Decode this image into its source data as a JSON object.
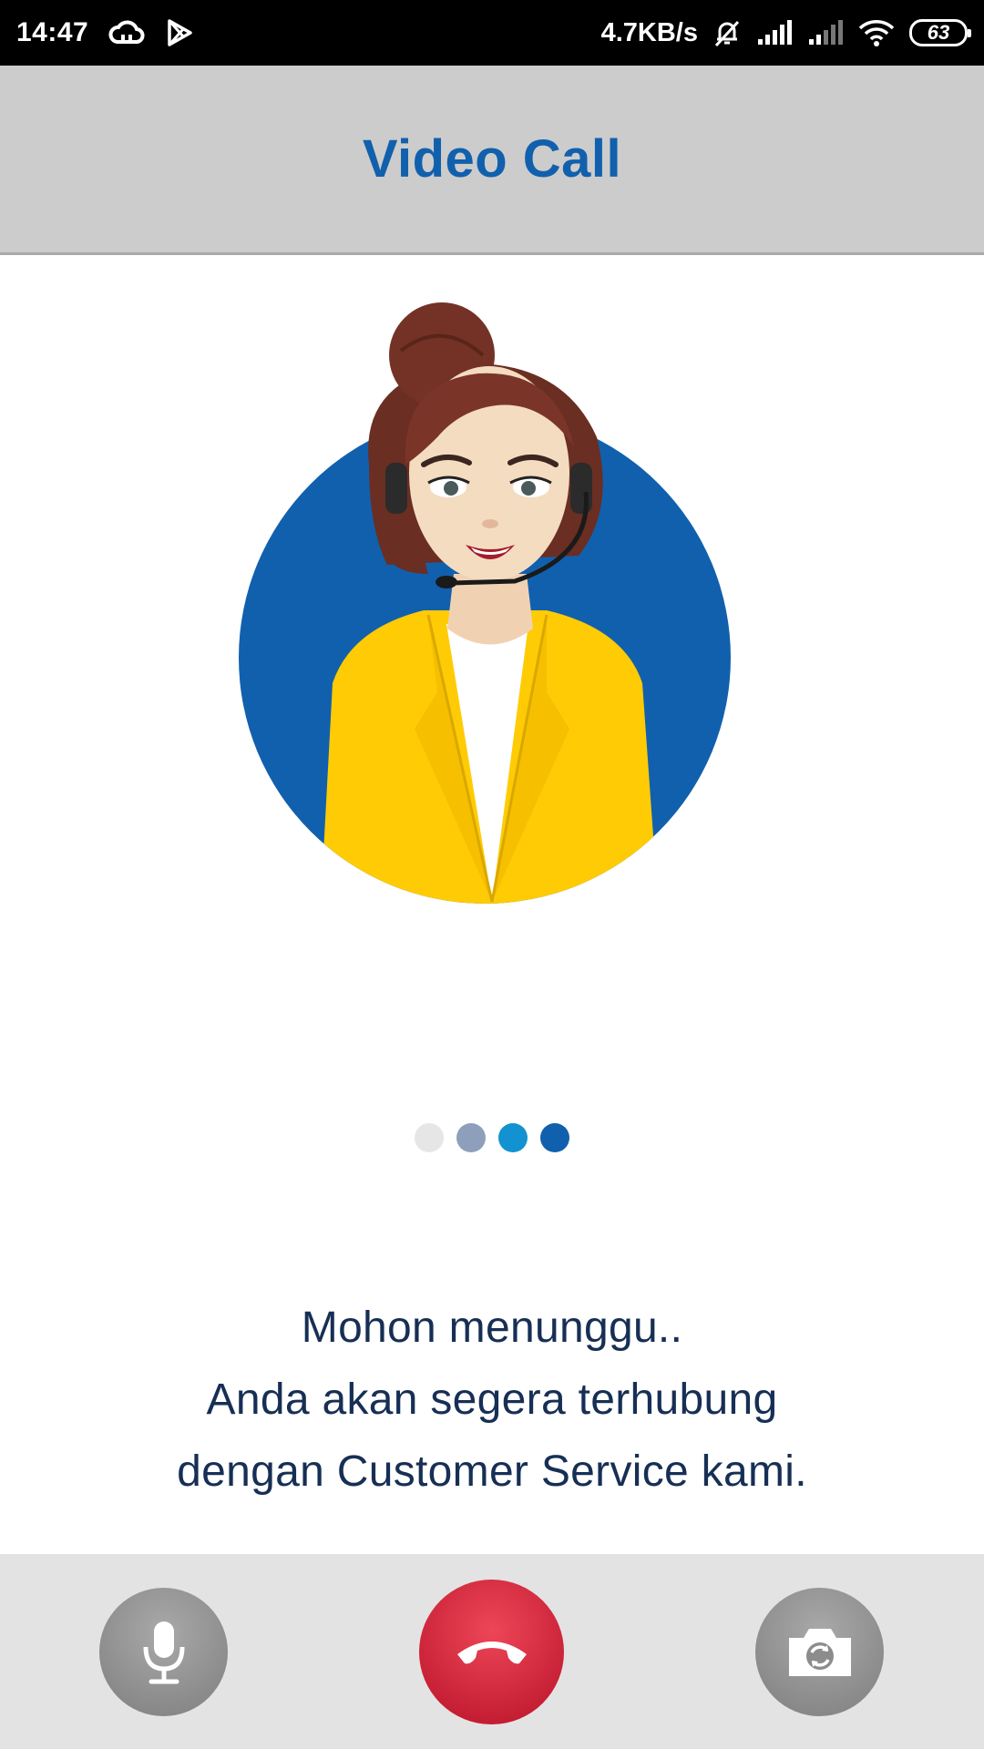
{
  "status_bar": {
    "time": "14:47",
    "net_speed": "4.7KB/s",
    "battery": "63",
    "icons": [
      "cloud-icon",
      "play-store-icon",
      "mute-bell-icon",
      "signal-icon",
      "signal-icon-2",
      "wifi-icon",
      "battery-icon"
    ]
  },
  "header": {
    "title": "Video Call",
    "title_color": "#1160ad",
    "background": "#cccccc"
  },
  "illustration": {
    "icon": "customer-service-agent-avatar",
    "circle_color": "#1160ad",
    "jacket_color": "#ffcb05"
  },
  "loading_dots": [
    "#e6e6e6",
    "#8e9fbb",
    "#1292d0",
    "#1160ad"
  ],
  "message": {
    "line1": "Mohon menunggu..",
    "line2": "Anda akan segera terhubung",
    "line3": "dengan Customer Service kami."
  },
  "controls": {
    "mic_icon": "microphone-icon",
    "end_call_icon": "phone-hangup-icon",
    "camera_icon": "camera-switch-icon",
    "end_call_color": "#d51a30"
  }
}
